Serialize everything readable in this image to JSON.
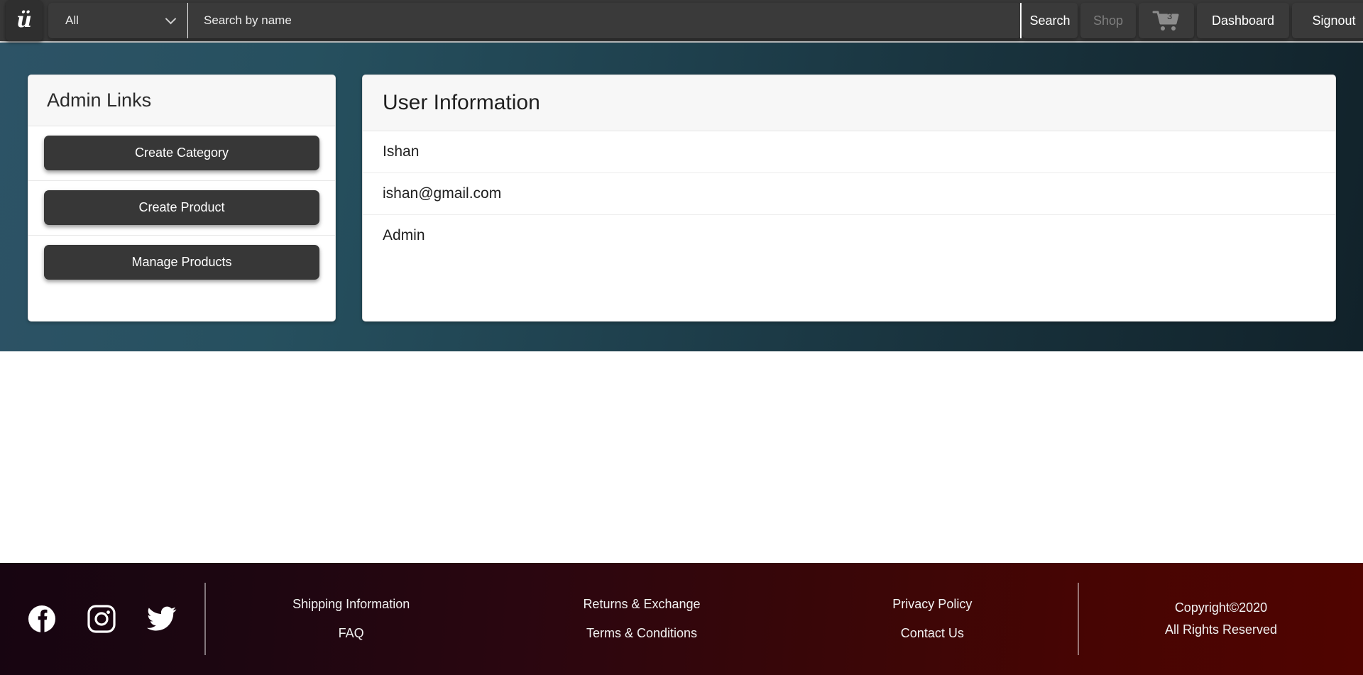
{
  "navbar": {
    "logo_glyph": "ü",
    "category_select": {
      "value": "All",
      "options": [
        "All"
      ]
    },
    "search": {
      "value": "",
      "placeholder": "Search by name"
    },
    "search_button": "Search",
    "shop_button": "Shop",
    "cart_count": "3",
    "dashboard_button": "Dashboard",
    "signout_button": "Signout"
  },
  "admin_panel": {
    "title": "Admin Links",
    "links": [
      {
        "label": "Create Category"
      },
      {
        "label": "Create Product"
      },
      {
        "label": "Manage Products"
      }
    ]
  },
  "user_panel": {
    "title": "User Information",
    "rows": [
      {
        "value": "Ishan"
      },
      {
        "value": "ishan@gmail.com"
      },
      {
        "value": "Admin"
      }
    ]
  },
  "footer": {
    "social": [
      {
        "name": "facebook"
      },
      {
        "name": "instagram"
      },
      {
        "name": "twitter"
      }
    ],
    "columns": [
      {
        "links": [
          "Shipping Information",
          "FAQ"
        ]
      },
      {
        "links": [
          "Returns & Exchange",
          "Terms & Conditions"
        ]
      },
      {
        "links": [
          "Privacy Policy",
          "Contact Us"
        ]
      }
    ],
    "copyright_line1": "Copyright©2020",
    "copyright_line2": "All Rights Reserved"
  },
  "colors": {
    "navbar_bg": "#373737",
    "hero_gradient_start": "#2d5366",
    "hero_gradient_end": "#11222a",
    "footer_gradient_start": "#170511",
    "footer_gradient_end": "#500400",
    "button_bg": "#373737",
    "card_head_bg": "#f7f7f7",
    "muted_text": "#7e7e7e"
  }
}
